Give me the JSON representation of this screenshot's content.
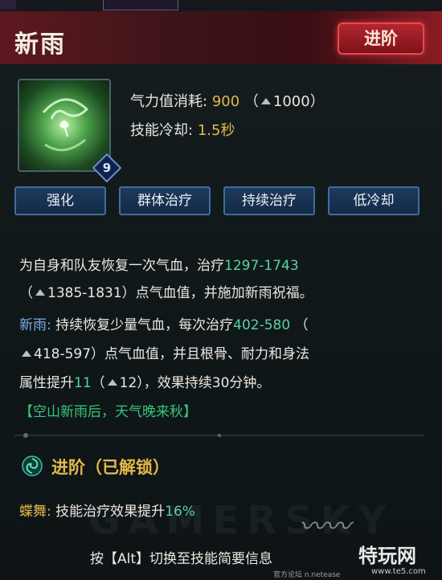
{
  "skill": {
    "name": "新雨",
    "advance_button": "进阶",
    "level": "9"
  },
  "stats": {
    "cost_label": "气力值消耗:",
    "cost_value": "900",
    "cost_upgrade_open": "（",
    "cost_upgrade_value": "1000",
    "cost_upgrade_close": "）",
    "cooldown_label": "技能冷却:",
    "cooldown_value": "1.5秒"
  },
  "tabs": [
    "强化",
    "群体治疗",
    "持续治疗",
    "低冷却"
  ],
  "description": {
    "line1_text": "为自身和队友恢复一次气血，治疗",
    "line1_value": "1297-1743",
    "line2_open": "（",
    "line2_value": "1385-1831",
    "line2_text": "）点气血值，并施加新雨祝福。",
    "line3_label": "新雨:",
    "line3_text": " 持续恢复少量气血，每次治疗",
    "line3_value": "402-580",
    "line3_open": " （",
    "line4_value": "418-597",
    "line4_text": "）点气血值，并且根骨、耐力和身法",
    "line5_text": "属性提升",
    "line5_value": "11",
    "line5_open": "（",
    "line5_up": "12",
    "line5_close": "），效果持续30分钟。",
    "quote": "【空山新雨后，天气晚来秋】"
  },
  "advance": {
    "title": "进阶（已解锁）",
    "effect_label": "蝶舞:",
    "effect_text": " 技能治疗效果提升",
    "effect_value": "16%"
  },
  "footer": {
    "hint": "按【Alt】切换至技能简要信息",
    "watermark": "GAMERSKY",
    "site_logo": "特玩网",
    "site_url": "www.te5.com",
    "site_small": "官方论坛 n.netease"
  },
  "colors": {
    "header": "#5e1820",
    "gold": "#e2b84a",
    "green": "#5cd0a0",
    "tab": "#1e3a5e"
  },
  "icons": [
    "skill-icon",
    "up-arrow-icon",
    "advance-swirl-icon"
  ]
}
